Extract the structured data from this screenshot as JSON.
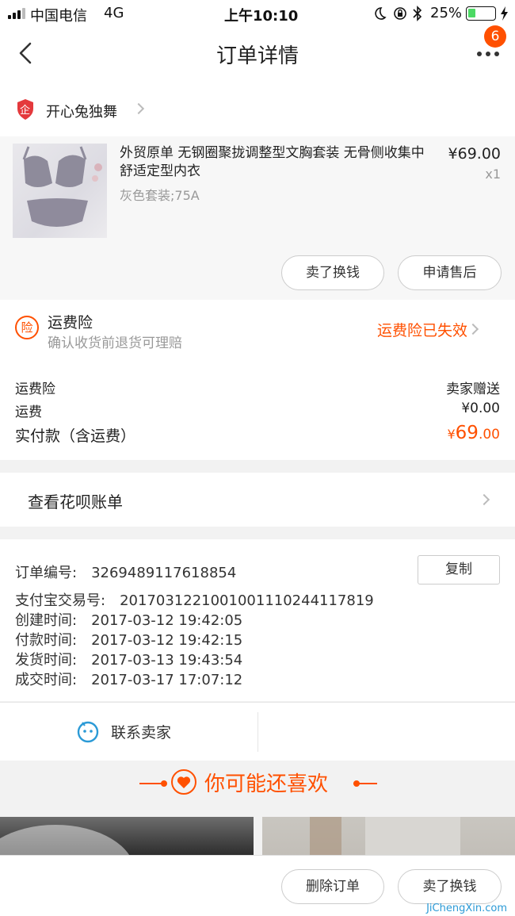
{
  "status_bar": {
    "carrier": "中国电信",
    "network": "4G",
    "time": "上午10:10",
    "battery": "25%"
  },
  "nav": {
    "title": "订单详情",
    "badge_count": "6"
  },
  "shop": {
    "name": "开心兔独舞",
    "icon_letter": "企"
  },
  "product": {
    "title": "外贸原单 无钢圈聚拢调整型文胸套装 无骨侧收集中舒适定型内衣",
    "sku": "灰色套装;75A",
    "price": "¥69.00",
    "quantity": "x1",
    "buttons": {
      "resell": "卖了换钱",
      "after_sale": "申请售后"
    }
  },
  "insurance": {
    "icon_label": "险",
    "title": "运费险",
    "subtitle": "确认收货前退货可理赔",
    "status": "运费险已失效"
  },
  "fees": {
    "insurance_label": "运费险",
    "insurance_value": "卖家赠送",
    "shipping_label": "运费",
    "shipping_value": "¥0.00",
    "paid_label": "实付款（含运费）",
    "paid_currency": "¥",
    "paid_int": "69",
    "paid_dec": ".00"
  },
  "huabei": {
    "label": "查看花呗账单"
  },
  "order_info": {
    "copy_label": "复制",
    "rows": [
      {
        "label": "订单编号:",
        "value": "3269489117618854"
      },
      {
        "label": "支付宝交易号:",
        "value": "2017031221001001110244117819"
      },
      {
        "label": "创建时间:",
        "value": "2017-03-12 19:42:05"
      },
      {
        "label": "付款时间:",
        "value": "2017-03-12 19:42:15"
      },
      {
        "label": "发货时间:",
        "value": "2017-03-13 19:43:54"
      },
      {
        "label": "成交时间:",
        "value": "2017-03-17 17:07:12"
      }
    ]
  },
  "contact": {
    "label": "联系卖家"
  },
  "recommend": {
    "title": "你可能还喜欢"
  },
  "bottom": {
    "delete_label": "删除订单",
    "resell_label": "卖了换钱"
  },
  "watermark": {
    "text": "JiChengXin.com"
  },
  "colors": {
    "accent": "#ff5000",
    "link_blue": "#2b9ad6"
  }
}
